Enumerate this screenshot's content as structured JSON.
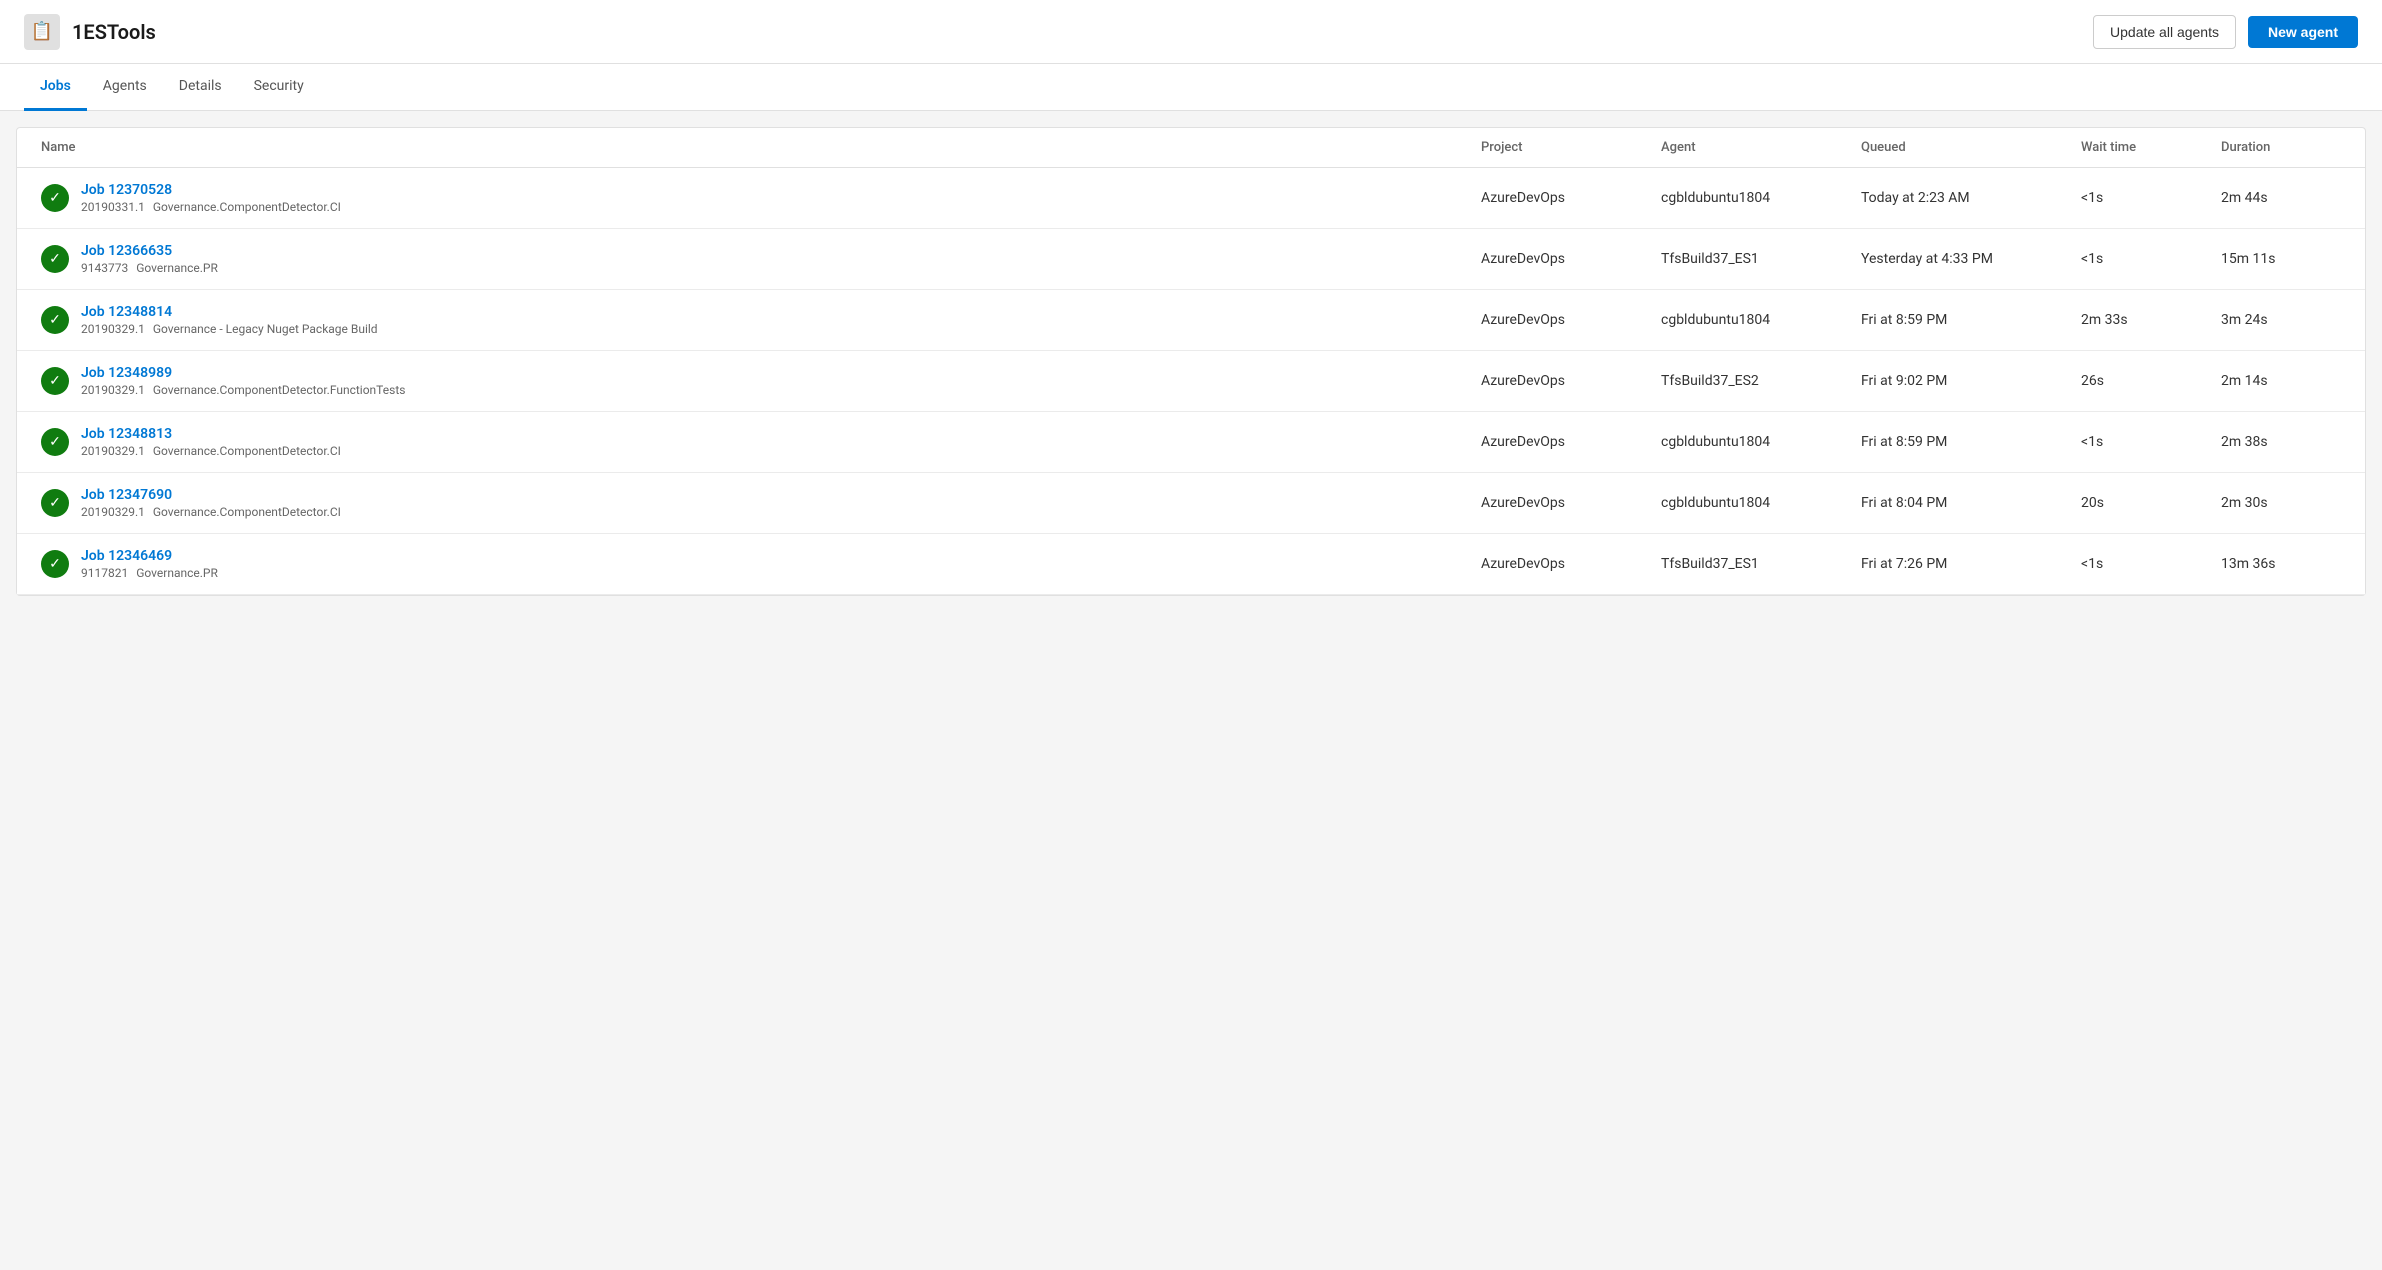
{
  "header": {
    "app_icon": "📋",
    "app_title": "1ESTools",
    "update_agents_label": "Update all agents",
    "new_agent_label": "New agent"
  },
  "tabs": [
    {
      "label": "Jobs",
      "active": true
    },
    {
      "label": "Agents",
      "active": false
    },
    {
      "label": "Details",
      "active": false
    },
    {
      "label": "Security",
      "active": false
    }
  ],
  "table": {
    "columns": [
      "Name",
      "Project",
      "Agent",
      "Queued",
      "Wait time",
      "Duration"
    ],
    "rows": [
      {
        "job_id": "Job 12370528",
        "sub_id": "20190331.1",
        "sub_name": "Governance.ComponentDetector.CI",
        "project": "AzureDevOps",
        "agent": "cgbldubuntu1804",
        "queued": "Today at 2:23 AM",
        "wait_time": "<1s",
        "duration": "2m 44s",
        "status": "success"
      },
      {
        "job_id": "Job 12366635",
        "sub_id": "9143773",
        "sub_name": "Governance.PR",
        "project": "AzureDevOps",
        "agent": "TfsBuild37_ES1",
        "queued": "Yesterday at 4:33 PM",
        "wait_time": "<1s",
        "duration": "15m 11s",
        "status": "success"
      },
      {
        "job_id": "Job 12348814",
        "sub_id": "20190329.1",
        "sub_name": "Governance - Legacy Nuget Package Build",
        "project": "AzureDevOps",
        "agent": "cgbldubuntu1804",
        "queued": "Fri at 8:59 PM",
        "wait_time": "2m 33s",
        "duration": "3m 24s",
        "status": "success"
      },
      {
        "job_id": "Job 12348989",
        "sub_id": "20190329.1",
        "sub_name": "Governance.ComponentDetector.FunctionTests",
        "project": "AzureDevOps",
        "agent": "TfsBuild37_ES2",
        "queued": "Fri at 9:02 PM",
        "wait_time": "26s",
        "duration": "2m 14s",
        "status": "success"
      },
      {
        "job_id": "Job 12348813",
        "sub_id": "20190329.1",
        "sub_name": "Governance.ComponentDetector.CI",
        "project": "AzureDevOps",
        "agent": "cgbldubuntu1804",
        "queued": "Fri at 8:59 PM",
        "wait_time": "<1s",
        "duration": "2m 38s",
        "status": "success"
      },
      {
        "job_id": "Job 12347690",
        "sub_id": "20190329.1",
        "sub_name": "Governance.ComponentDetector.CI",
        "project": "AzureDevOps",
        "agent": "cgbldubuntu1804",
        "queued": "Fri at 8:04 PM",
        "wait_time": "20s",
        "duration": "2m 30s",
        "status": "success"
      },
      {
        "job_id": "Job 12346469",
        "sub_id": "9117821",
        "sub_name": "Governance.PR",
        "project": "AzureDevOps",
        "agent": "TfsBuild37_ES1",
        "queued": "Fri at 7:26 PM",
        "wait_time": "<1s",
        "duration": "13m 36s",
        "status": "success"
      }
    ]
  }
}
